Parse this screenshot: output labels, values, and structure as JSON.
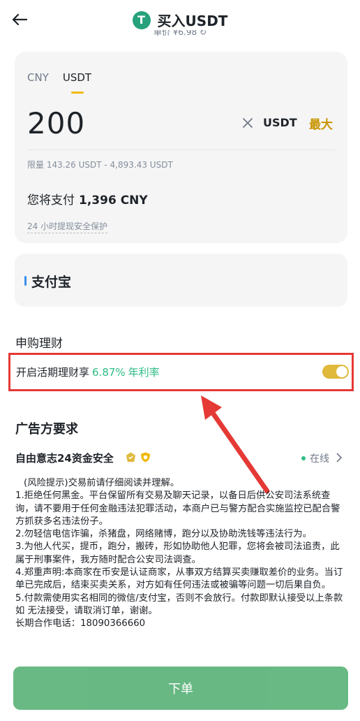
{
  "header": {
    "title": "买入USDT",
    "logo_letter": "T",
    "unit_price": "单价 ¥6.98 ↻"
  },
  "amount_card": {
    "tabs": [
      "CNY",
      "USDT"
    ],
    "active_tab": "USDT",
    "amount": "200",
    "currency": "USDT",
    "max_label": "最大",
    "limit": "限量 143.26 USDT - 4,893.43 USDT",
    "pay_label": "您将支付",
    "pay_amount": "1,396 CNY",
    "protect": "24 小时提现安全保护"
  },
  "payment": {
    "method": "支付宝"
  },
  "earn": {
    "section_title": "申购理财",
    "label": "开启活期理财享",
    "rate": "6.87%",
    "rate_label": "年利率",
    "toggle_on": true
  },
  "advertiser": {
    "section_title": "广告方要求",
    "name": "自由意志24资金安全",
    "status": "在线",
    "terms": [
      "(风险提示)交易前请仔细阅读并理解。",
      "1.拒绝任何黑金。平台保留所有交易及聊天记录，以备日后供公安司法系统查询，请不要用于任何金融违法犯罪活动，本商户已与警方配合实施监控已配合警方抓获多名违法份子。",
      "2.勿轻信电信诈骗，杀猪盘，网络赌博，跑分以及协助洗钱等违法行为。",
      "3.为他人代买，提币，跑分，搬砖，形如协助他人犯罪，您将会被司法追责，此属于刑事案件，我方随时配合公安司法调查。",
      "4.郑重声明:本商家在币安是认证商家，从事双方结算买卖赚取差价的业务。当订单已完成后，结束买卖关系，对方如有任何违法或被骗等问题一切后果自负。",
      "5.付款需使用实名相同的微信/支付宝，否则不会放行。付款即默认接受以上条款如 无法接受，请取消订单，谢谢。",
      "长期合作电话：18090366660"
    ]
  },
  "order_button": "下单",
  "colors": {
    "accent": "#f0b90b",
    "green": "#2ebd85",
    "button": "#5cb37a",
    "highlight": "#e53935"
  }
}
